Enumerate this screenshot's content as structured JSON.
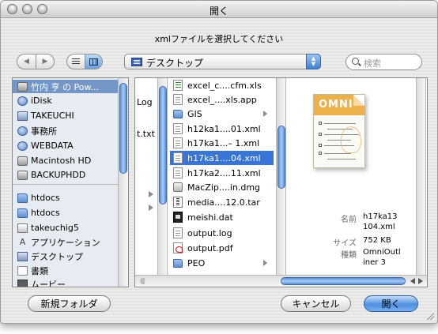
{
  "window": {
    "title": "開く",
    "prompt": "xmlファイルを選択してください"
  },
  "toolbar": {
    "back_label": "◀",
    "forward_label": "▶",
    "location": "デスクトップ",
    "search_placeholder": "検索"
  },
  "sidebar": {
    "items": [
      {
        "label": "竹内 亨 の Pow...",
        "icon": "computer-icon",
        "selected": true
      },
      {
        "label": "iDisk",
        "icon": "idisk-icon"
      },
      {
        "label": "TAKEUCHI",
        "icon": "user-icon"
      },
      {
        "label": "事務所",
        "icon": "network-icon"
      },
      {
        "label": "WEBDATA",
        "icon": "network-icon"
      },
      {
        "label": "Macintosh HD",
        "icon": "hard-drive-icon"
      },
      {
        "label": "BACKUPHDD",
        "icon": "hard-drive-icon"
      },
      {
        "label": "htdocs",
        "icon": "folder-icon"
      },
      {
        "label": "htdocs",
        "icon": "folder-icon"
      },
      {
        "label": "takeuchig5",
        "icon": "home-icon"
      },
      {
        "label": "アプリケーション",
        "icon": "applications-icon"
      },
      {
        "label": "デスクトップ",
        "icon": "desktop-icon"
      },
      {
        "label": "書類",
        "icon": "documents-icon"
      },
      {
        "label": "ムービー",
        "icon": "movies-icon"
      }
    ]
  },
  "browser": {
    "previous_column": [
      {
        "text": "Log"
      },
      {
        "text": "t.txt"
      }
    ],
    "files": [
      {
        "name": "excel_c....cfm.xls",
        "icon": "xls-icon",
        "folder": false
      },
      {
        "name": "excel_....xls.app",
        "icon": "xls-app-icon",
        "folder": false
      },
      {
        "name": "GIS",
        "icon": "folder-icon",
        "folder": true
      },
      {
        "name": "h12ka1....01.xml",
        "icon": "xml-file-icon",
        "folder": false
      },
      {
        "name": "h17ka1...– 1.xml",
        "icon": "xml-file-icon",
        "folder": false
      },
      {
        "name": "h17ka1....04.xml",
        "icon": "xml-file-icon",
        "folder": false,
        "selected": true
      },
      {
        "name": "h17ka2....11.xml",
        "icon": "xml-file-icon",
        "folder": false
      },
      {
        "name": "MacZip....in.dmg",
        "icon": "disk-image-icon",
        "folder": false
      },
      {
        "name": "media....12.0.tar",
        "icon": "tar-archive-icon",
        "folder": false
      },
      {
        "name": "meishi.dat",
        "icon": "executable-icon",
        "folder": false
      },
      {
        "name": "output.log",
        "icon": "log-file-icon",
        "folder": false
      },
      {
        "name": "output.pdf",
        "icon": "pdf-icon",
        "folder": false
      },
      {
        "name": "PEO",
        "icon": "folder-icon",
        "folder": true
      }
    ],
    "preview": {
      "logo_text": "OMNI",
      "name_label": "名前",
      "name_value_1": "h17ka13",
      "name_value_2": "104.xml",
      "size_label": "サイズ",
      "size_value": "752 KB",
      "kind_label": "種類",
      "kind_value_1": "OmniOutl",
      "kind_value_2": "iner 3"
    }
  },
  "buttons": {
    "new_folder": "新規フォルダ",
    "cancel": "キャンセル",
    "open": "開く"
  },
  "colors": {
    "selection": "#3875d7",
    "sidebar_selection": "#7597c8",
    "default_button": "#4f90e3"
  }
}
